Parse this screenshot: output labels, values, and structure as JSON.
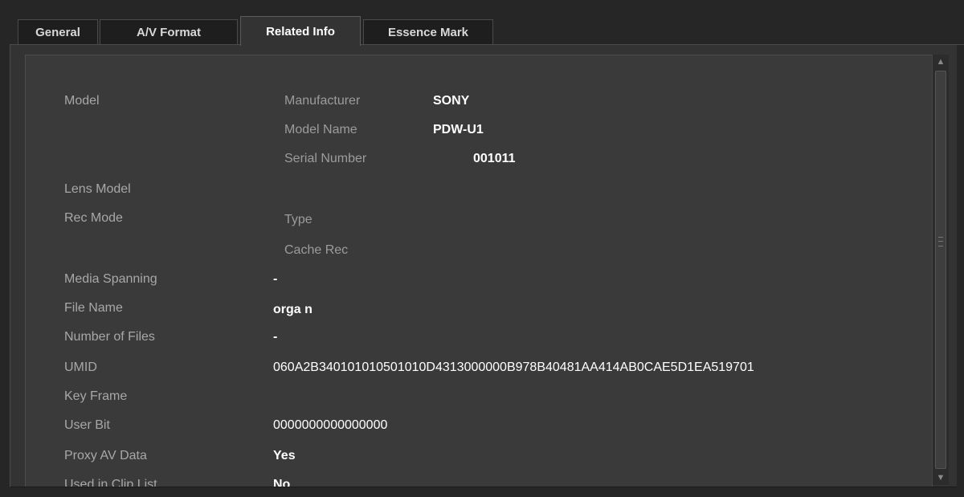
{
  "tabs": [
    {
      "label": "General"
    },
    {
      "label": "A/V Format"
    },
    {
      "label": "Related Info"
    },
    {
      "label": "Essence Mark"
    }
  ],
  "rows": {
    "model_label": "Model",
    "manufacturer_label": "Manufacturer",
    "manufacturer_value": "SONY",
    "model_name_label": "Model Name",
    "model_name_value": "PDW-U1",
    "serial_label": "Serial Number",
    "serial_value": "001011",
    "lens_model_label": "Lens Model",
    "rec_mode_label": "Rec Mode",
    "type_label": "Type",
    "cache_rec_label": "Cache Rec",
    "media_spanning_label": "Media Spanning",
    "media_spanning_value": "-",
    "file_name_label": "File Name",
    "file_name_value": "orga n",
    "number_of_files_label": "Number of Files",
    "number_of_files_value": "-",
    "umid_label": "UMID",
    "umid_value": "060A2B340101010501010D4313000000B978B40481AA414AB0CAE5D1EA519701",
    "key_frame_label": "Key Frame",
    "user_bit_label": "User Bit",
    "user_bit_value": "0000000000000000",
    "proxy_av_label": "Proxy AV Data",
    "proxy_av_value": "Yes",
    "used_in_clip_label": "Used in Clip List",
    "used_in_clip_value": "No"
  }
}
